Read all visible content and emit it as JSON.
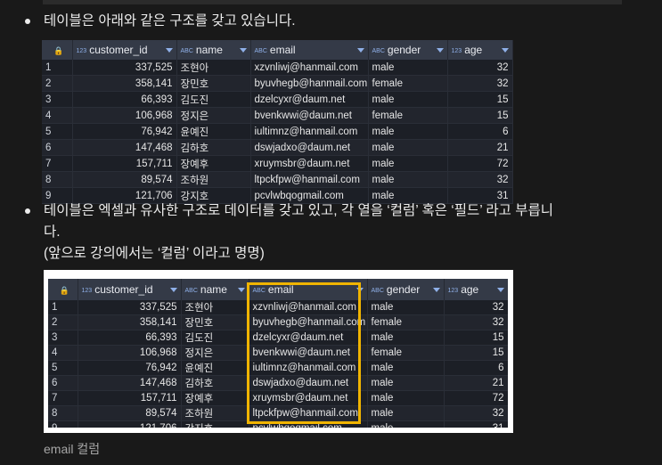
{
  "bullets": {
    "b1": "테이블은 아래와 같은 구조를 갖고 있습니다.",
    "b2_line1": "테이블은 엑셀과 유사한 구조로 데이터를 갖고 있고, 각 열을 ‘컬럼’ 혹은 ‘필드’ 라고 부릅니",
    "b2_line2": "다.",
    "b2_line3": "(앞으로 강의에서는 ‘컬럼’ 이라고 명명)"
  },
  "caption": "email 컬럼",
  "table": {
    "type_tags": {
      "number": "123",
      "text": "ABC"
    },
    "columns": [
      "customer_id",
      "name",
      "email",
      "gender",
      "age"
    ],
    "rows": [
      {
        "n": "1",
        "customer_id": "337,525",
        "name": "조현아",
        "email": "xzvnliwj@hanmail.com",
        "gender": "male",
        "age": "32"
      },
      {
        "n": "2",
        "customer_id": "358,141",
        "name": "장민호",
        "email": "byuvhegb@hanmail.com",
        "gender": "female",
        "age": "32"
      },
      {
        "n": "3",
        "customer_id": "66,393",
        "name": "김도진",
        "email": "dzelcyxr@daum.net",
        "gender": "male",
        "age": "15"
      },
      {
        "n": "4",
        "customer_id": "106,968",
        "name": "정지은",
        "email": "bvenkwwi@daum.net",
        "gender": "female",
        "age": "15"
      },
      {
        "n": "5",
        "customer_id": "76,942",
        "name": "윤예진",
        "email": "iultimnz@hanmail.com",
        "gender": "male",
        "age": "6"
      },
      {
        "n": "6",
        "customer_id": "147,468",
        "name": "김하호",
        "email": "dswjadxo@daum.net",
        "gender": "male",
        "age": "21"
      },
      {
        "n": "7",
        "customer_id": "157,711",
        "name": "장예후",
        "email": "xruymsbr@daum.net",
        "gender": "male",
        "age": "72"
      },
      {
        "n": "8",
        "customer_id": "89,574",
        "name": "조하원",
        "email": "ltpckfpw@hanmail.com",
        "gender": "male",
        "age": "32"
      },
      {
        "n": "9",
        "customer_id": "121,706",
        "name": "강지호",
        "email": "pcvlwbqogmail.com",
        "gender": "male",
        "age": "31"
      }
    ]
  },
  "colors": {
    "highlight": "#f0b400",
    "background": "#191919",
    "header": "#343a47"
  }
}
